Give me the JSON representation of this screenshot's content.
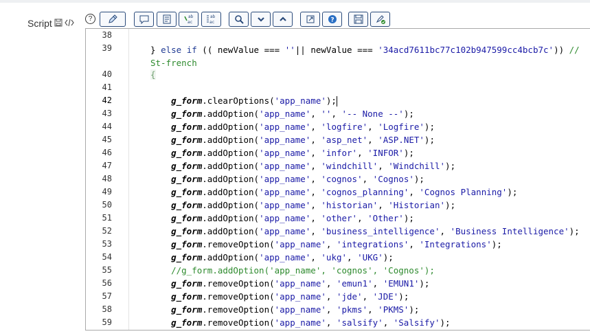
{
  "field": {
    "label": "Script"
  },
  "toolbar": [
    {
      "name": "toggle-syntax-button",
      "icon": "pencil-icon"
    },
    {
      "name": "comment-button",
      "icon": "speech-bubble-icon"
    },
    {
      "name": "format-button",
      "icon": "document-lines-icon"
    },
    {
      "name": "replace-button",
      "icon": "replace-text-icon"
    },
    {
      "name": "replace-all-button",
      "icon": "replace-all-icon"
    },
    {
      "name": "search-button",
      "icon": "magnifier-icon"
    },
    {
      "name": "find-next-button",
      "icon": "chevron-down-icon"
    },
    {
      "name": "find-previous-button",
      "icon": "chevron-up-icon"
    },
    {
      "name": "fullscreen-button",
      "icon": "expand-icon"
    },
    {
      "name": "help-button",
      "icon": "question-icon"
    },
    {
      "name": "save-button",
      "icon": "floppy-disk-icon"
    },
    {
      "name": "script-check-button",
      "icon": "script-check-icon"
    }
  ],
  "lines": [
    {
      "n": "38",
      "html": ""
    },
    {
      "n": "39",
      "wrap": true,
      "html": "} <span class='kw'>else</span> <span class='kw'>if</span> (( newValue === <span class='str'>''</span>|| newValue === <span class='str'>'34acd7611bc77c102b947599cc4bcb7c'</span>)) <span class='cm'>//</span>\n<span class='cm'>St-french</span>"
    },
    {
      "n": "40",
      "html": "<span class='brace'>{</span>"
    },
    {
      "n": "41",
      "html": ""
    },
    {
      "n": "42",
      "active": true,
      "html": "    <span class='gf'>g_form</span>.clearOptions(<span class='str'>'app_name'</span>);<span class='cursor'></span>"
    },
    {
      "n": "43",
      "html": "    <span class='gf'>g_form</span>.addOption(<span class='str'>'app_name'</span>, <span class='str'>''</span>, <span class='str'>'-- None --'</span>);"
    },
    {
      "n": "44",
      "html": "    <span class='gf'>g_form</span>.addOption(<span class='str'>'app_name'</span>, <span class='str'>'logfire'</span>, <span class='str'>'Logfire'</span>);"
    },
    {
      "n": "45",
      "html": "    <span class='gf'>g_form</span>.addOption(<span class='str'>'app_name'</span>, <span class='str'>'asp_net'</span>, <span class='str'>'ASP.NET'</span>);"
    },
    {
      "n": "46",
      "html": "    <span class='gf'>g_form</span>.addOption(<span class='str'>'app_name'</span>, <span class='str'>'infor'</span>, <span class='str'>'INFOR'</span>);"
    },
    {
      "n": "47",
      "html": "    <span class='gf'>g_form</span>.addOption(<span class='str'>'app_name'</span>, <span class='str'>'windchill'</span>, <span class='str'>'Windchill'</span>);"
    },
    {
      "n": "48",
      "html": "    <span class='gf'>g_form</span>.addOption(<span class='str'>'app_name'</span>, <span class='str'>'cognos'</span>, <span class='str'>'Cognos'</span>);"
    },
    {
      "n": "49",
      "html": "    <span class='gf'>g_form</span>.addOption(<span class='str'>'app_name'</span>, <span class='str'>'cognos_planning'</span>, <span class='str'>'Cognos Planning'</span>);"
    },
    {
      "n": "50",
      "html": "    <span class='gf'>g_form</span>.addOption(<span class='str'>'app_name'</span>, <span class='str'>'historian'</span>, <span class='str'>'Historian'</span>);"
    },
    {
      "n": "51",
      "html": "    <span class='gf'>g_form</span>.addOption(<span class='str'>'app_name'</span>, <span class='str'>'other'</span>, <span class='str'>'Other'</span>);"
    },
    {
      "n": "52",
      "html": "    <span class='gf'>g_form</span>.addOption(<span class='str'>'app_name'</span>, <span class='str'>'business_intelligence'</span>, <span class='str'>'Business Intelligence'</span>);"
    },
    {
      "n": "53",
      "html": "    <span class='gf'>g_form</span>.removeOption(<span class='str'>'app_name'</span>, <span class='str'>'integrations'</span>, <span class='str'>'Integrations'</span>);"
    },
    {
      "n": "54",
      "html": "    <span class='gf'>g_form</span>.addOption(<span class='str'>'app_name'</span>, <span class='str'>'ukg'</span>, <span class='str'>'UKG'</span>);"
    },
    {
      "n": "55",
      "html": "    <span class='cm'>//g_form.addOption('app_name', 'cognos', 'Cognos');</span>"
    },
    {
      "n": "56",
      "html": "    <span class='gf'>g_form</span>.removeOption(<span class='str'>'app_name'</span>, <span class='str'>'emun1'</span>, <span class='str'>'EMUN1'</span>);"
    },
    {
      "n": "57",
      "html": "    <span class='gf'>g_form</span>.removeOption(<span class='str'>'app_name'</span>, <span class='str'>'jde'</span>, <span class='str'>'JDE'</span>);"
    },
    {
      "n": "58",
      "html": "    <span class='gf'>g_form</span>.removeOption(<span class='str'>'app_name'</span>, <span class='str'>'pkms'</span>, <span class='str'>'PKMS'</span>);"
    },
    {
      "n": "59",
      "html": "    <span class='gf'>g_form</span>.removeOption(<span class='str'>'app_name'</span>, <span class='str'>'salsify'</span>, <span class='str'>'Salsify'</span>);"
    }
  ]
}
